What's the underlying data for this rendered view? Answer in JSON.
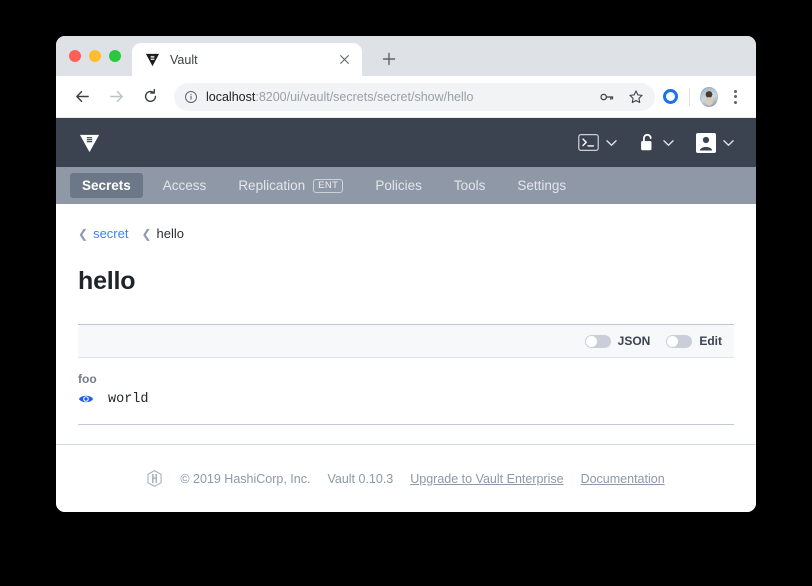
{
  "browser": {
    "tab": {
      "title": "Vault",
      "favicon_icon": "vault-logo-icon",
      "close_icon": "close-icon"
    },
    "new_tab_label": "+",
    "back_icon": "back-arrow-icon",
    "forward_icon": "forward-arrow-icon",
    "reload_icon": "reload-icon",
    "omnibox": {
      "info_icon": "info-circle-icon",
      "url_host": "localhost",
      "url_path": ":8200/ui/vault/secrets/secret/show/hello",
      "url_full": "localhost:8200/ui/vault/secrets/secret/show/hello",
      "key_icon": "password-key-icon",
      "bookmark_icon": "star-icon"
    },
    "extension_icon": "blue-ring-extension-icon",
    "avatar_icon": "profile-avatar",
    "menu_icon": "three-dot-menu-icon"
  },
  "vault": {
    "logo_icon": "vault-logo-icon",
    "header_actions": [
      {
        "icon": "console-terminal-icon",
        "chevron": "chevron-down-icon"
      },
      {
        "icon": "unlock-icon",
        "chevron": "chevron-down-icon"
      },
      {
        "icon": "user-icon",
        "chevron": "chevron-down-icon"
      }
    ],
    "nav": [
      {
        "label": "Secrets",
        "active": true,
        "badge": ""
      },
      {
        "label": "Access",
        "active": false,
        "badge": ""
      },
      {
        "label": "Replication",
        "active": false,
        "badge": "ENT"
      },
      {
        "label": "Policies",
        "active": false,
        "badge": ""
      },
      {
        "label": "Tools",
        "active": false,
        "badge": ""
      },
      {
        "label": "Settings",
        "active": false,
        "badge": ""
      }
    ],
    "breadcrumb": [
      {
        "label": "secret",
        "is_link": true
      },
      {
        "label": "hello",
        "is_link": false
      }
    ],
    "page_title": "hello",
    "toolbar": {
      "json_label": "JSON",
      "json_on": false,
      "edit_label": "Edit",
      "edit_on": false
    },
    "secrets": [
      {
        "key": "foo",
        "value": "world",
        "reveal_icon": "eye-icon"
      }
    ],
    "footer": {
      "logo_icon": "hashicorp-logo-icon",
      "copyright": "© 2019 HashiCorp, Inc.",
      "version": "Vault 0.10.3",
      "links": [
        {
          "label": "Upgrade to Vault Enterprise"
        },
        {
          "label": "Documentation"
        }
      ]
    },
    "colors": {
      "header_bg": "#3b4350",
      "nav_bg": "#8e98a6",
      "nav_active_bg": "#6c7788",
      "link_blue": "#3b82f6",
      "eye_blue": "#1d5cf2"
    }
  }
}
